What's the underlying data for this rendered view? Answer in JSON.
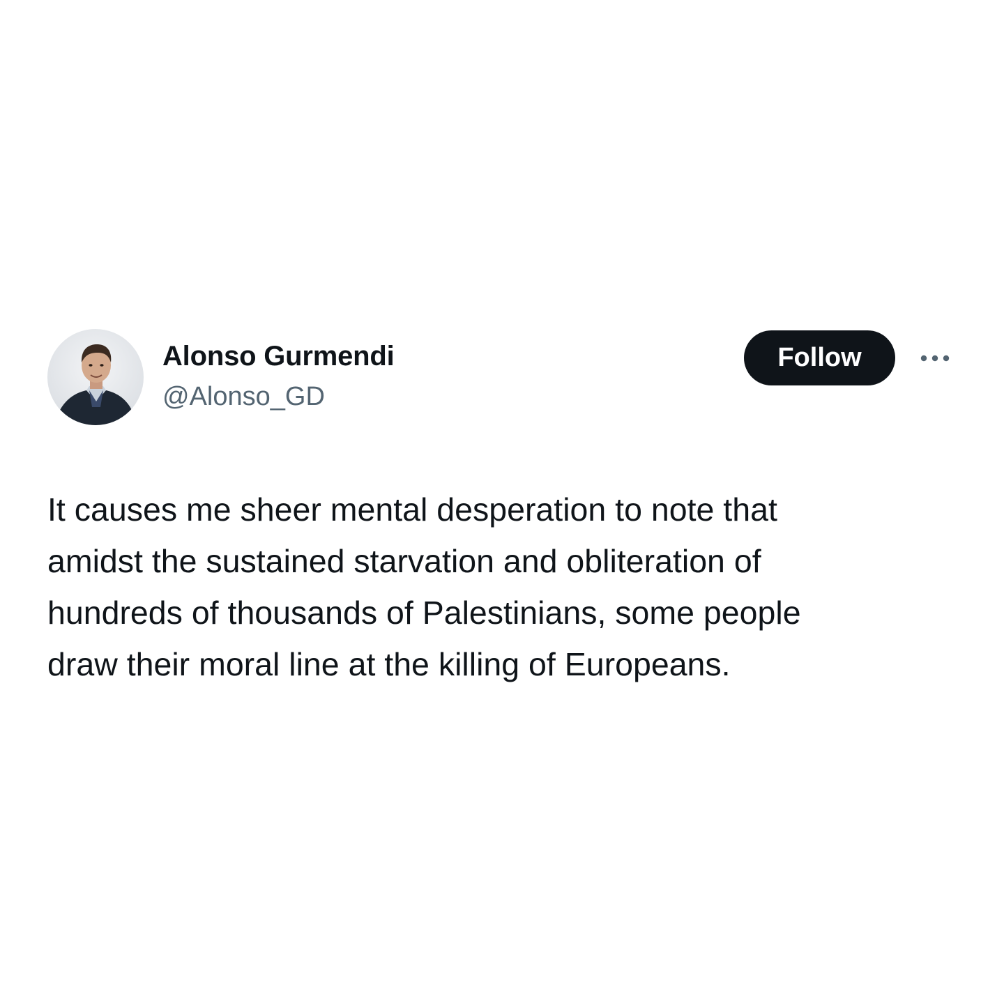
{
  "tweet": {
    "author": {
      "display_name": "Alonso Gurmendi",
      "handle": "@Alonso_GD"
    },
    "follow_label": "Follow",
    "more_icon": "more-dots-icon",
    "text": "It causes me sheer mental desperation to note that\namidst the sustained starvation and obliteration of\nhundreds of thousands of Palestinians, some people\ndraw their moral line at the killing of Europeans."
  },
  "colors": {
    "background": "#ffffff",
    "text_primary": "#0f1419",
    "text_secondary": "#536471",
    "follow_button_bg": "#0f1419",
    "follow_button_text": "#ffffff"
  }
}
